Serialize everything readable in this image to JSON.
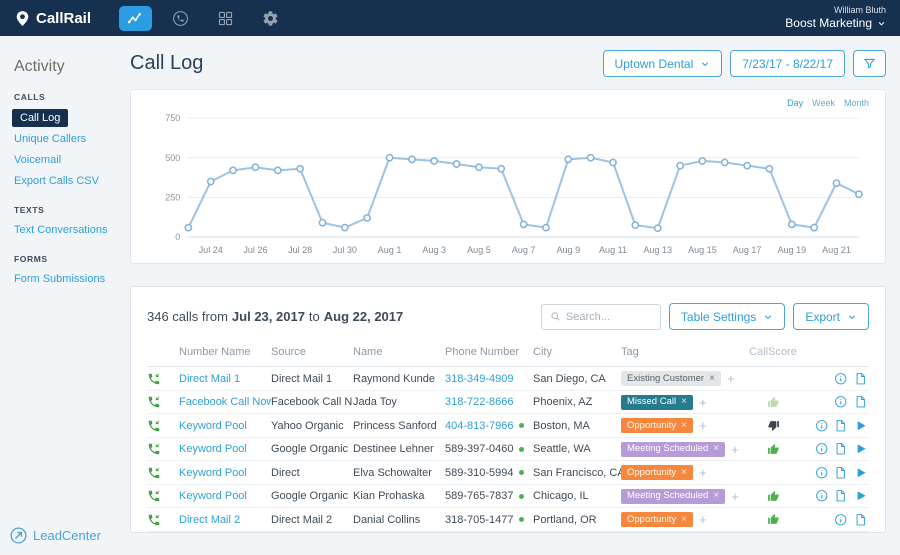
{
  "navbar": {
    "brand": "CallRail",
    "user_name": "William Bluth",
    "account_name": "Boost Marketing",
    "icons": [
      {
        "icon": "analytics-icon",
        "active": true
      },
      {
        "icon": "phone-icon",
        "active": false
      },
      {
        "icon": "integrations-icon",
        "active": false
      },
      {
        "icon": "settings-gear-icon",
        "active": false
      }
    ]
  },
  "sidebar": {
    "title": "Activity",
    "sections": [
      {
        "header": "CALLS",
        "items": [
          {
            "label": "Call Log",
            "active": true
          },
          {
            "label": "Unique Callers",
            "active": false
          },
          {
            "label": "Voicemail",
            "active": false
          },
          {
            "label": "Export Calls CSV",
            "active": false
          }
        ]
      },
      {
        "header": "TEXTS",
        "items": [
          {
            "label": "Text Conversations",
            "active": false
          }
        ]
      },
      {
        "header": "FORMS",
        "items": [
          {
            "label": "Form Submissions",
            "active": false
          }
        ]
      }
    ],
    "footer_brand": "LeadCenter"
  },
  "header": {
    "title": "Call Log",
    "company_selector": "Uptown Dental",
    "date_range": "7/23/17 - 8/22/17"
  },
  "chart": {
    "granularity": [
      "Day",
      "Week",
      "Month"
    ],
    "active_granularity": "Day"
  },
  "chart_data": {
    "type": "line",
    "x": [
      "Jul 23",
      "Jul 24",
      "Jul 25",
      "Jul 26",
      "Jul 27",
      "Jul 28",
      "Jul 29",
      "Jul 30",
      "Jul 31",
      "Aug 1",
      "Aug 2",
      "Aug 3",
      "Aug 4",
      "Aug 5",
      "Aug 6",
      "Aug 7",
      "Aug 8",
      "Aug 9",
      "Aug 10",
      "Aug 11",
      "Aug 12",
      "Aug 13",
      "Aug 14",
      "Aug 15",
      "Aug 16",
      "Aug 17",
      "Aug 18",
      "Aug 19",
      "Aug 20",
      "Aug 21",
      "Aug 22"
    ],
    "values": [
      60,
      350,
      420,
      440,
      420,
      430,
      90,
      60,
      120,
      500,
      490,
      480,
      460,
      440,
      430,
      80,
      60,
      490,
      500,
      470,
      75,
      55,
      450,
      480,
      470,
      450,
      430,
      80,
      60,
      340,
      270
    ],
    "ylim": [
      0,
      750
    ],
    "yticks": [
      0,
      250,
      500,
      750
    ],
    "xtick_labels": [
      "Jul 24",
      "Jul 26",
      "Jul 28",
      "Jul 30",
      "Aug 1",
      "Aug 3",
      "Aug 5",
      "Aug 7",
      "Aug 9",
      "Aug 11",
      "Aug 13",
      "Aug 15",
      "Aug 17",
      "Aug 19",
      "Aug 21"
    ],
    "grid": true,
    "legend": false
  },
  "summary": {
    "prefix": "346 calls from",
    "start_date": "Jul 23, 2017",
    "to_word": "to",
    "end_date": "Aug 22, 2017",
    "search_placeholder": "Search...",
    "table_settings_label": "Table Settings",
    "export_label": "Export"
  },
  "table": {
    "columns": [
      "",
      "Number Name",
      "Source",
      "Name",
      "Phone Number",
      "City",
      "Tag",
      "CallScore",
      ""
    ],
    "tag_remove_glyph": "×",
    "tag_add_glyph": "+",
    "rows": [
      {
        "number_name": "Direct Mail 1",
        "source": "Direct Mail 1",
        "name": "Raymond Kunde",
        "phone": "318-349-4909",
        "phone_link": true,
        "phone_dot": false,
        "city": "San Diego, CA",
        "tag": {
          "label": "Existing Customer",
          "color": "gray"
        },
        "score": null,
        "actions": [
          "info",
          "doc"
        ]
      },
      {
        "number_name": "Facebook Call Now",
        "source": "Facebook Call Now",
        "name": "Jada Toy",
        "phone": "318-722-8666",
        "phone_link": true,
        "phone_dot": false,
        "city": "Phoenix, AZ",
        "tag": {
          "label": "Missed Call",
          "color": "teal"
        },
        "score": "up-light",
        "actions": [
          "info",
          "doc"
        ]
      },
      {
        "number_name": "Keyword Pool",
        "source": "Yahoo Organic",
        "name": "Princess Sanford",
        "phone": "404-813-7966",
        "phone_link": true,
        "phone_dot": true,
        "city": "Boston, MA",
        "tag": {
          "label": "Opportunity",
          "color": "orange"
        },
        "score": "down-dark",
        "actions": [
          "info",
          "doc",
          "play"
        ]
      },
      {
        "number_name": "Keyword Pool",
        "source": "Google Organic",
        "name": "Destinee Lehner",
        "phone": "589-397-0460",
        "phone_link": false,
        "phone_dot": true,
        "city": "Seattle, WA",
        "tag": {
          "label": "Meeting Scheduled",
          "color": "purple"
        },
        "score": "up-green",
        "actions": [
          "info",
          "doc",
          "play"
        ]
      },
      {
        "number_name": "Keyword Pool",
        "source": "Direct",
        "name": "Elva Schowalter",
        "phone": "589-310-5994",
        "phone_link": false,
        "phone_dot": true,
        "city": "San Francisco, CA",
        "tag": {
          "label": "Opportunity",
          "color": "orange"
        },
        "score": null,
        "actions": [
          "info",
          "doc",
          "play"
        ]
      },
      {
        "number_name": "Keyword Pool",
        "source": "Google Organic",
        "name": "Kian Prohaska",
        "phone": "589-765-7837",
        "phone_link": false,
        "phone_dot": true,
        "city": "Chicago, IL",
        "tag": {
          "label": "Meeting Scheduled",
          "color": "purple"
        },
        "score": "up-green",
        "actions": [
          "info",
          "doc",
          "play"
        ]
      },
      {
        "number_name": "Direct Mail 2",
        "source": "Direct Mail 2",
        "name": "Danial Collins",
        "phone": "318-705-1477",
        "phone_link": false,
        "phone_dot": true,
        "city": "Portland, OR",
        "tag": {
          "label": "Opportunity",
          "color": "orange"
        },
        "score": "up-green",
        "actions": [
          "info",
          "doc"
        ]
      }
    ]
  },
  "colors": {
    "accent_blue": "#2d9fd8",
    "navy": "#16304f",
    "green": "#43a047",
    "line_blue": "#9cc3e5",
    "tag_gray": "#e3e7ea",
    "tag_teal": "#277b8e",
    "tag_orange": "#f5883c",
    "tag_purple": "#b79bd6"
  }
}
